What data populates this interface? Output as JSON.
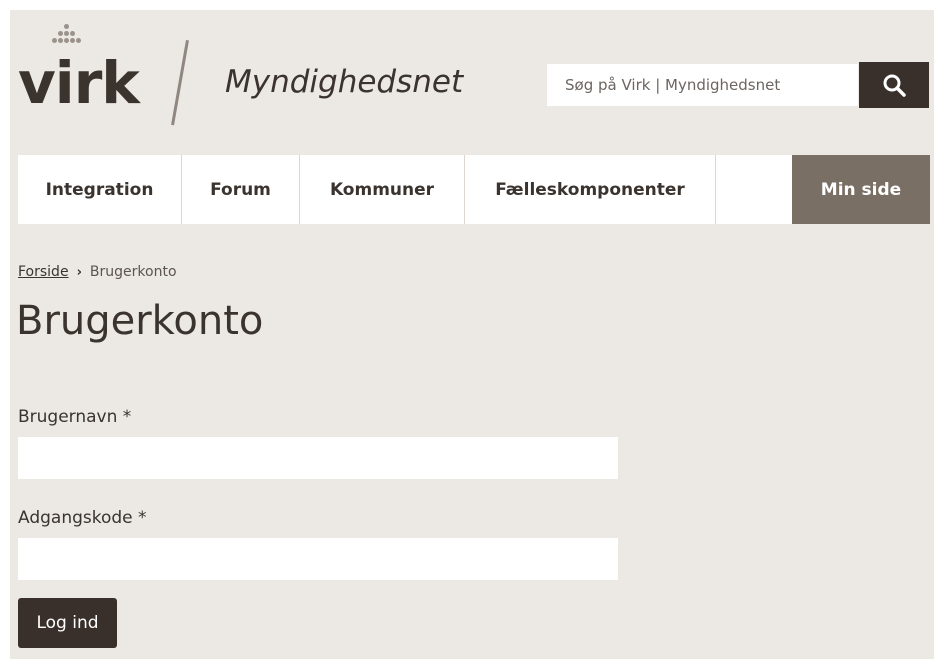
{
  "header": {
    "logo_text": "virk",
    "site_name": "Myndighedsnet",
    "search_placeholder": "Søg på Virk | Myndighedsnet"
  },
  "nav": {
    "items": [
      {
        "label": "Integration"
      },
      {
        "label": "Forum"
      },
      {
        "label": "Kommuner"
      },
      {
        "label": "Fælleskomponenter"
      }
    ],
    "my_page_label": "Min side"
  },
  "breadcrumb": {
    "home": "Forside",
    "separator": "›",
    "current": "Brugerkonto"
  },
  "page_title": "Brugerkonto",
  "form": {
    "username_label": "Brugernavn *",
    "username_value": "",
    "password_label": "Adgangskode *",
    "password_value": "",
    "submit_label": "Log ind"
  },
  "colors": {
    "background": "#ece8e4",
    "dark": "#3a302b",
    "accent_nav": "#7a6f65"
  },
  "icons": {
    "search": "search-icon"
  }
}
